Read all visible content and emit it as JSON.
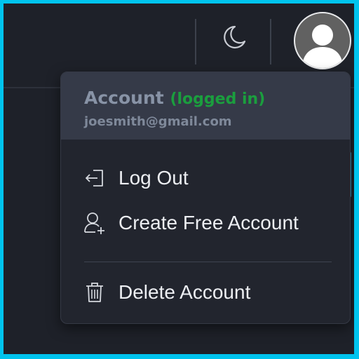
{
  "header": {
    "theme_toggle_icon": "moon-icon",
    "avatar_icon": "user-avatar-icon"
  },
  "account_menu": {
    "title": "Account",
    "status": "(logged in)",
    "email": "joesmith@gmail.com",
    "items": [
      {
        "label": "Log Out",
        "icon": "logout-icon"
      },
      {
        "label": "Create Free Account",
        "icon": "add-user-icon"
      },
      {
        "label": "Delete Account",
        "icon": "trash-icon"
      }
    ]
  },
  "colors": {
    "frame_border": "#00c4ee",
    "background": "#1e2129",
    "menu_header": "#353a48",
    "status_green": "#1b9e3e",
    "text": "#eceef2"
  }
}
